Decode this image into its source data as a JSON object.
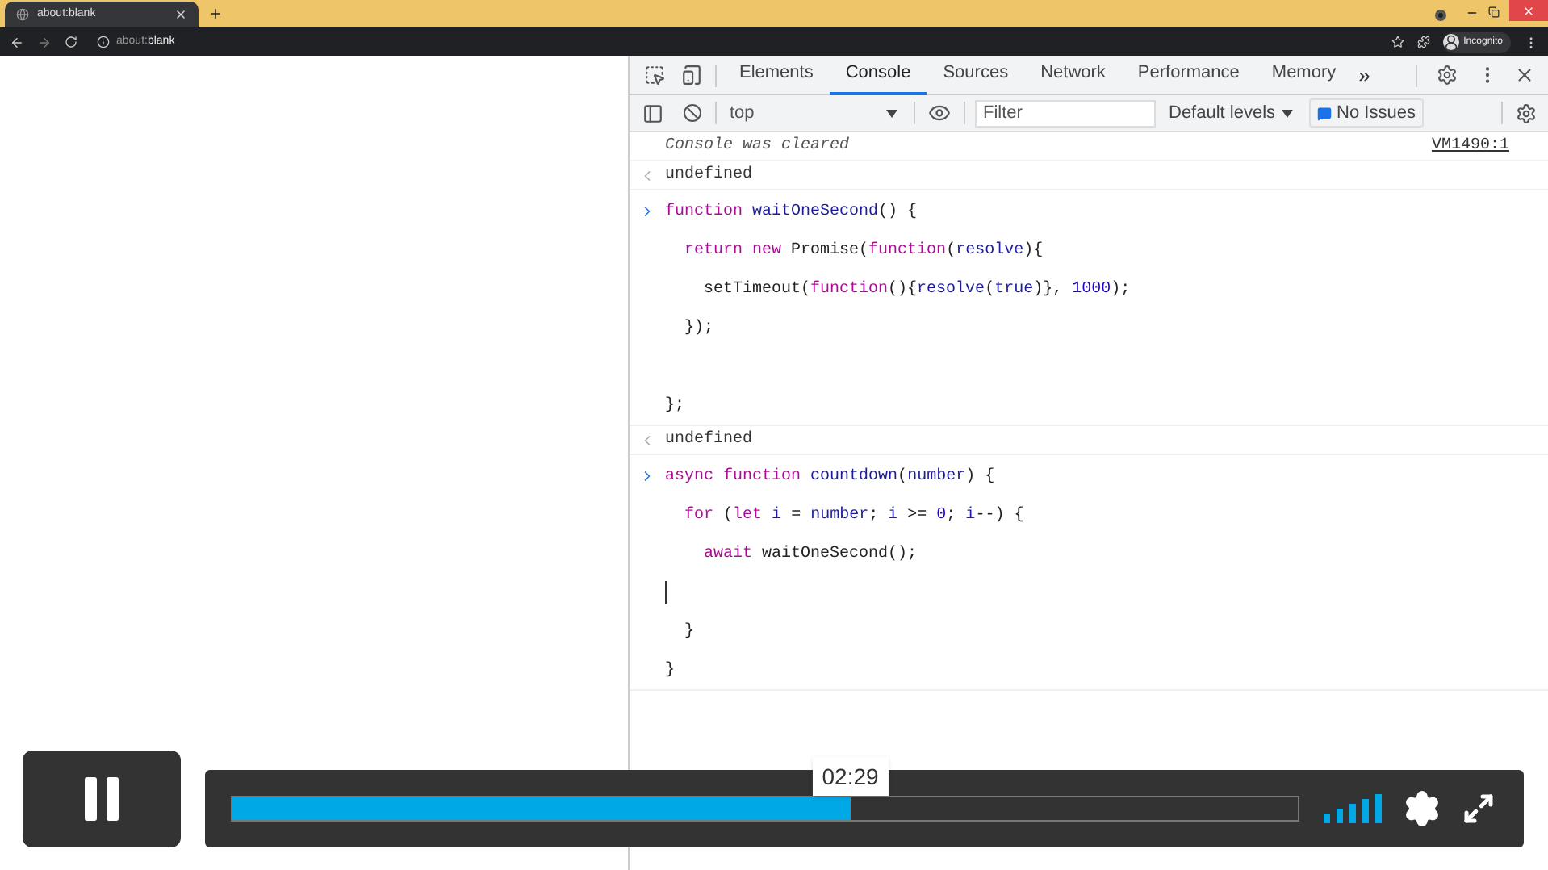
{
  "browser": {
    "tab": {
      "title": "about:blank"
    },
    "address": {
      "prefix": "about:",
      "host": "blank"
    },
    "profile": "Incognito"
  },
  "devtools": {
    "tabs": [
      {
        "label": "Elements",
        "selected": false
      },
      {
        "label": "Console",
        "selected": true
      },
      {
        "label": "Sources",
        "selected": false
      },
      {
        "label": "Network",
        "selected": false
      },
      {
        "label": "Performance",
        "selected": false
      },
      {
        "label": "Memory",
        "selected": false
      }
    ],
    "more": "»",
    "context": "top",
    "filter": {
      "placeholder": "Filter"
    },
    "levels": "Default levels",
    "issues": "No Issues",
    "messages": [
      {
        "kind": "info",
        "text": "Console was cleared",
        "source": "VM1490:1"
      },
      {
        "kind": "output",
        "text": "undefined"
      },
      {
        "kind": "input",
        "lines": [
          {
            "kind": "code",
            "tokens": [
              {
                "text": "function",
                "kind": "kw"
              },
              {
                "text": " waitOneSecond",
                "kind": "name"
              },
              {
                "text": "() {",
                "kind": "plain"
              }
            ],
            "children": [
              {
                "kind": "code",
                "tokens": [
                  {
                    "text": "return",
                    "kind": "kw"
                  },
                  {
                    "text": " new",
                    "kind": "kw"
                  },
                  {
                    "text": " Promise(",
                    "kind": "plain"
                  },
                  {
                    "text": "function",
                    "kind": "kw"
                  },
                  {
                    "text": "(",
                    "kind": "plain"
                  },
                  {
                    "text": "resolve",
                    "kind": "name"
                  },
                  {
                    "text": "){",
                    "kind": "plain"
                  }
                ],
                "children": [
                  {
                    "kind": "code",
                    "tokens": [
                      {
                        "text": "setTimeout(",
                        "kind": "plain"
                      },
                      {
                        "text": "function",
                        "kind": "kw"
                      },
                      {
                        "text": "(){",
                        "kind": "plain"
                      },
                      {
                        "text": "resolve",
                        "kind": "name"
                      },
                      {
                        "text": "(",
                        "kind": "plain"
                      },
                      {
                        "text": "true",
                        "kind": "name"
                      },
                      {
                        "text": ")},",
                        "kind": "plain"
                      },
                      {
                        "text": " 1000",
                        "kind": "num"
                      },
                      {
                        "text": ");",
                        "kind": "plain"
                      }
                    ]
                  }
                ]
              },
              {
                "kind": "code",
                "tokens": [
                  {
                    "text": "});",
                    "kind": "plain"
                  }
                ]
              },
              {
                "kind": "blank"
              }
            ]
          },
          {
            "kind": "code",
            "tokens": [
              {
                "text": "};",
                "kind": "plain"
              }
            ]
          }
        ]
      },
      {
        "kind": "output",
        "text": "undefined"
      },
      {
        "kind": "input",
        "lines": [
          {
            "kind": "code",
            "tokens": [
              {
                "text": "async",
                "kind": "kw"
              },
              {
                "text": " function",
                "kind": "kw"
              },
              {
                "text": " countdown",
                "kind": "name"
              },
              {
                "text": "(",
                "kind": "plain"
              },
              {
                "text": "number",
                "kind": "name"
              },
              {
                "text": ") {",
                "kind": "plain"
              }
            ],
            "children": [
              {
                "kind": "code",
                "tokens": [
                  {
                    "text": "for",
                    "kind": "kw"
                  },
                  {
                    "text": " (",
                    "kind": "plain"
                  },
                  {
                    "text": "let",
                    "kind": "kw"
                  },
                  {
                    "text": " i",
                    "kind": "name"
                  },
                  {
                    "text": " =",
                    "kind": "plain"
                  },
                  {
                    "text": " number",
                    "kind": "name"
                  },
                  {
                    "text": ";",
                    "kind": "plain"
                  },
                  {
                    "text": " i",
                    "kind": "name"
                  },
                  {
                    "text": " >=",
                    "kind": "plain"
                  },
                  {
                    "text": " 0",
                    "kind": "num"
                  },
                  {
                    "text": ";",
                    "kind": "plain"
                  },
                  {
                    "text": " i",
                    "kind": "name"
                  },
                  {
                    "text": "--) {",
                    "kind": "plain"
                  }
                ],
                "children": [
                  {
                    "kind": "code",
                    "tokens": [
                      {
                        "text": "await",
                        "kind": "kw"
                      },
                      {
                        "text": " waitOneSecond();",
                        "kind": "plain"
                      }
                    ]
                  }
                ]
              }
            ]
          },
          {
            "kind": "cursor",
            "children": [
              {
                "kind": "code",
                "tokens": [
                  {
                    "text": "}",
                    "kind": "plain"
                  }
                ]
              }
            ]
          },
          {
            "kind": "code",
            "tokens": [
              {
                "text": "}",
                "kind": "plain"
              }
            ]
          }
        ]
      }
    ]
  },
  "player": {
    "playing": true,
    "progress": {
      "level": 0.58,
      "time": "02:29"
    }
  }
}
